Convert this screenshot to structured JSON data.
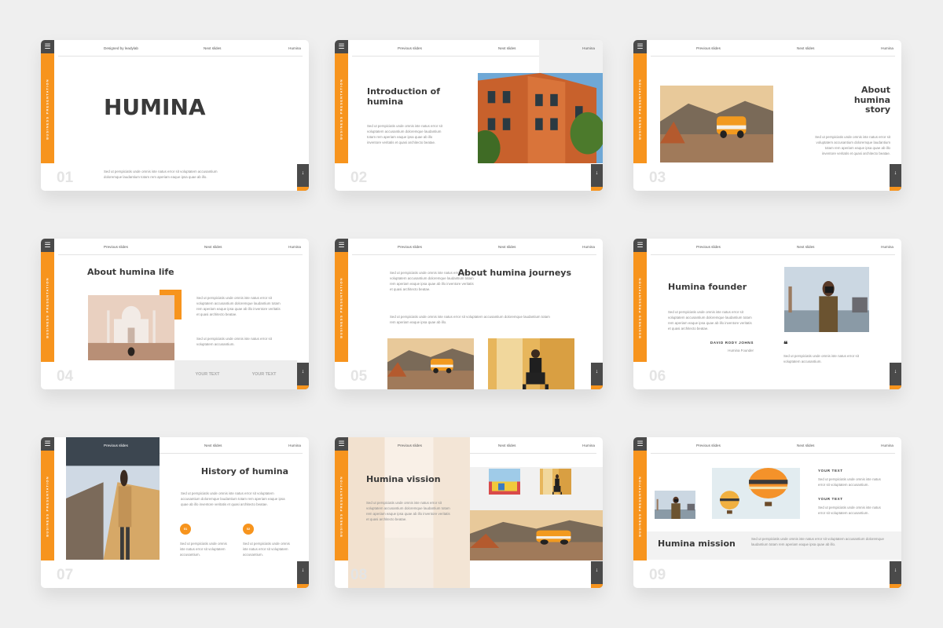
{
  "rail": {
    "label": "BUSINESS PRESENTATION",
    "menu_icon": "hamburger-menu-icon"
  },
  "nav": {
    "designed": "Designed by leadylab",
    "previous": "Previous slides",
    "next": "Next slides",
    "brand": "Humina"
  },
  "next_icon": "arrow-down-icon",
  "colors": {
    "accent": "#f7941d",
    "dark": "#4a4a4a",
    "background": "#efefef",
    "number": "#e4e4e4"
  },
  "lorem": {
    "short": "Sed ut perspiciatis unde omnis iste natus error sit voluptatem accusantium doloremque laudantium totam rem aperiam eaque ipsa quae ab illo.",
    "medium": "Sed ut perspiciatis unde omnis iste natus error sit voluptatem accusantium doloremque laudantium totam rem aperiam eaque ipsa quae ab illo inventore veritatis et quasi architecto beatae.",
    "tiny": "Sed ut perspiciatis unde omnis iste natus error sit voluptatem accusantium."
  },
  "slides": [
    {
      "num": "01",
      "title": "HUMINA"
    },
    {
      "num": "02",
      "title": "Introduction of humina"
    },
    {
      "num": "03",
      "title": "About humina story"
    },
    {
      "num": "04",
      "title": "About humina life",
      "cell1": "YOUR TEXT",
      "cell2": "YOUR TEXT"
    },
    {
      "num": "05",
      "title": "About humina journeys"
    },
    {
      "num": "06",
      "title": "Humina founder",
      "name": "DAVID RODY JOHNS",
      "role": "Humina Founder"
    },
    {
      "num": "07",
      "title": "History of humina",
      "step1": "01",
      "step2": "02"
    },
    {
      "num": "08",
      "title": "Humina vission"
    },
    {
      "num": "09",
      "title": "Humina mission",
      "label1": "YOUR TEXT",
      "label2": "YOUR TEXT"
    }
  ]
}
